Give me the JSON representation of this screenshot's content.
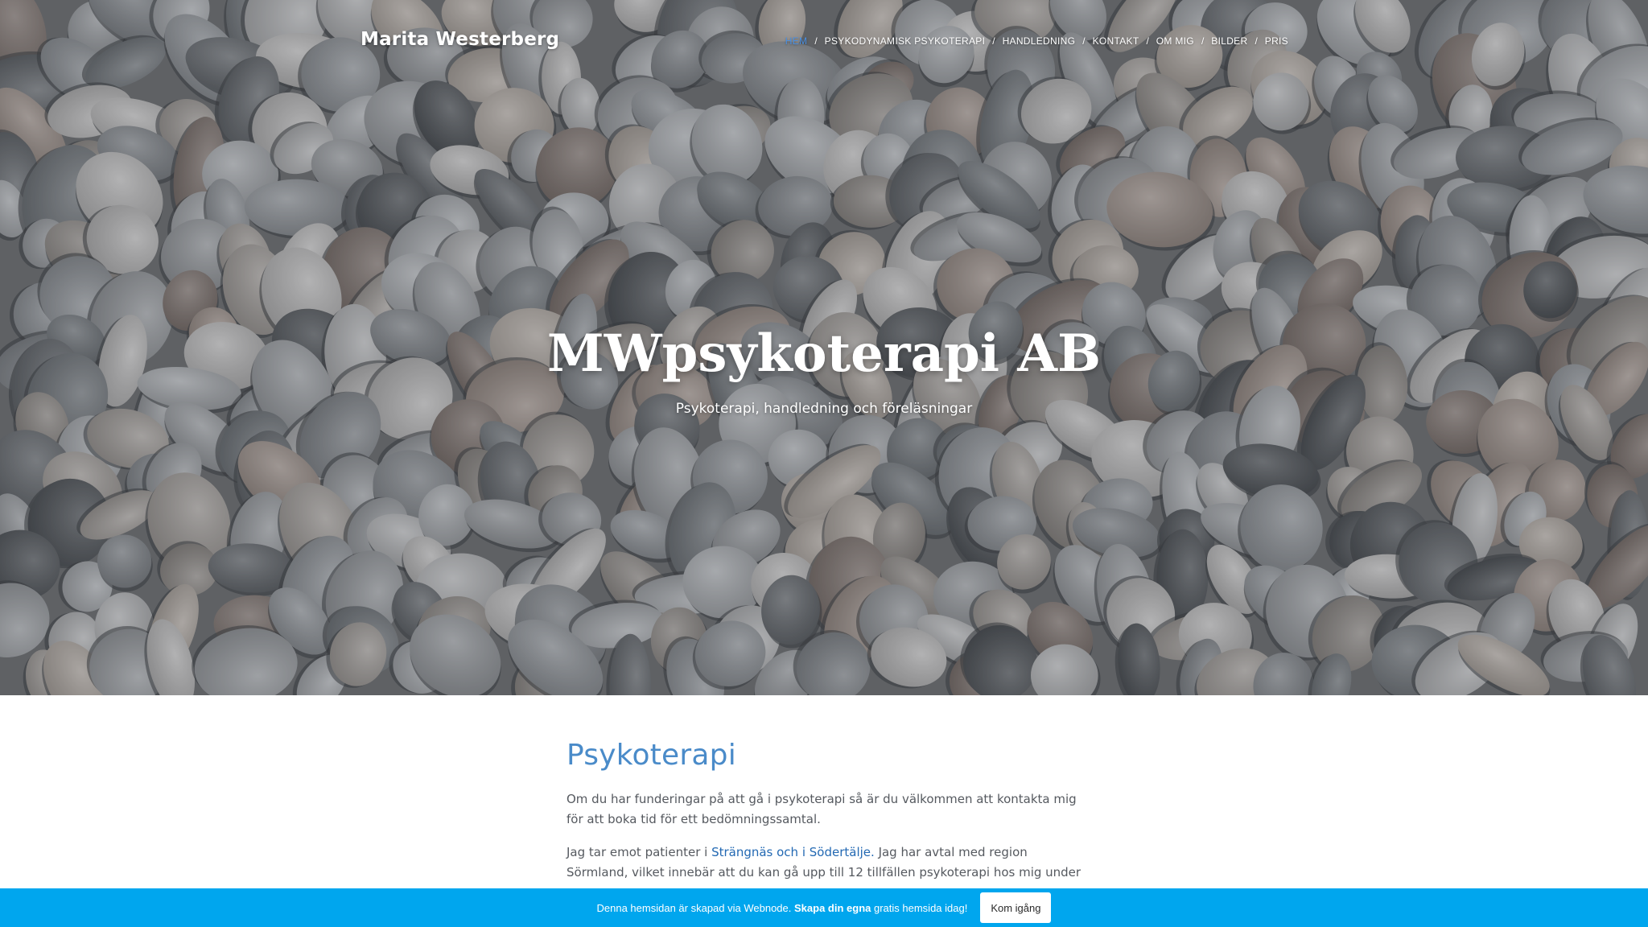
{
  "header": {
    "logo": "Marita Westerberg",
    "nav": [
      {
        "label": "HEM",
        "active": true
      },
      {
        "label": "PSYKODYNAMISK PSYKOTERAPI",
        "active": false
      },
      {
        "label": "HANDLEDNING",
        "active": false
      },
      {
        "label": "KONTAKT",
        "active": false
      },
      {
        "label": "OM MIG",
        "active": false
      },
      {
        "label": "BILDER",
        "active": false
      },
      {
        "label": "PRIS",
        "active": false
      }
    ],
    "separator": "/"
  },
  "hero": {
    "title": "MWpsykoterapi AB",
    "subtitle": "Psykoterapi, handledning och föreläsningar"
  },
  "main": {
    "heading": "Psykoterapi",
    "paragraph1": "Om du har funderingar på att gå i psykoterapi så är du välkommen att kontakta mig för att boka tid för ett bedömningssamtal.",
    "paragraph2_prefix": "Jag tar emot patienter i ",
    "paragraph2_link": "Strängnäs och i Södertälje.",
    "paragraph2_suffix": " Jag har avtal med region Sörmland, vilket innebär att du kan gå upp till 12 tillfällen psykoterapi hos mig under"
  },
  "banner": {
    "text_prefix": "Denna hemsidan är skapad via Webnode. ",
    "text_bold": "Skapa din egna",
    "text_suffix": " gratis hemsida idag!",
    "button_label": "Kom igång"
  },
  "colors": {
    "accent": "#4a8bc9",
    "link": "#2369b3",
    "banner": "#00a6ee",
    "nav_active": "#4a90e2"
  }
}
